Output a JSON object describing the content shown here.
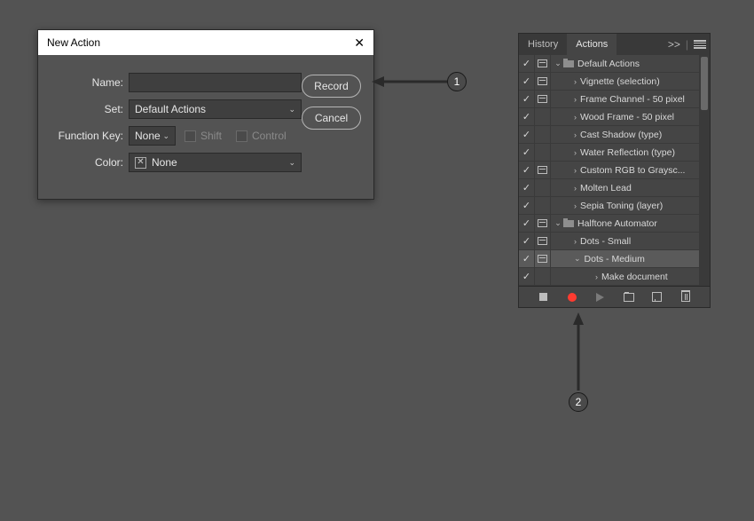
{
  "dialog": {
    "title": "New Action",
    "labels": {
      "name": "Name:",
      "set": "Set:",
      "fkey": "Function Key:",
      "color": "Color:"
    },
    "name_value": "",
    "set_value": "Default Actions",
    "fkey_value": "None",
    "shift_label": "Shift",
    "control_label": "Control",
    "color_value": "None",
    "buttons": {
      "record": "Record",
      "cancel": "Cancel"
    }
  },
  "panel": {
    "tabs": {
      "history": "History",
      "actions": "Actions"
    },
    "collapse_label": ">>",
    "rows": [
      {
        "check": true,
        "dlg": true,
        "type": "set",
        "expanded": true,
        "label": "Default Actions"
      },
      {
        "check": true,
        "dlg": true,
        "type": "action",
        "indent": 1,
        "label": "Vignette (selection)"
      },
      {
        "check": true,
        "dlg": true,
        "type": "action",
        "indent": 1,
        "label": "Frame Channel - 50 pixel"
      },
      {
        "check": true,
        "dlg": false,
        "type": "action",
        "indent": 1,
        "label": "Wood Frame - 50 pixel"
      },
      {
        "check": true,
        "dlg": false,
        "type": "action",
        "indent": 1,
        "label": "Cast Shadow (type)"
      },
      {
        "check": true,
        "dlg": false,
        "type": "action",
        "indent": 1,
        "label": "Water Reflection (type)"
      },
      {
        "check": true,
        "dlg": true,
        "type": "action",
        "indent": 1,
        "label": "Custom RGB to Graysc..."
      },
      {
        "check": true,
        "dlg": false,
        "type": "action",
        "indent": 1,
        "label": "Molten Lead"
      },
      {
        "check": true,
        "dlg": false,
        "type": "action",
        "indent": 1,
        "label": "Sepia Toning (layer)"
      },
      {
        "check": true,
        "dlg": true,
        "type": "set",
        "expanded": true,
        "label": "Halftone Automator"
      },
      {
        "check": true,
        "dlg": true,
        "type": "action",
        "indent": 1,
        "label": "Dots - Small"
      },
      {
        "check": true,
        "dlg": true,
        "type": "action",
        "indent": 1,
        "expanded": true,
        "selected": true,
        "label": "Dots - Medium"
      },
      {
        "check": true,
        "dlg": false,
        "type": "step",
        "indent": 2,
        "label": "Make document"
      }
    ]
  },
  "callouts": {
    "one": "1",
    "two": "2"
  }
}
